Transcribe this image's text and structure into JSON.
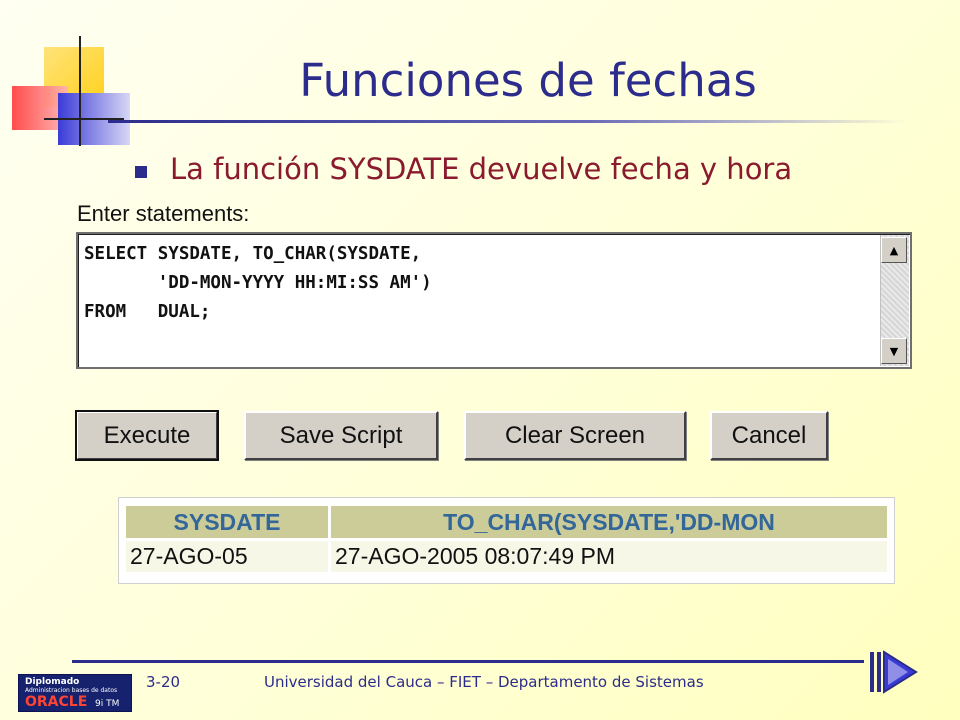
{
  "slide": {
    "title": "Funciones de fechas",
    "bullet": "La función SYSDATE devuelve fecha y hora"
  },
  "editor": {
    "label": "Enter statements:",
    "sql": "SELECT SYSDATE, TO_CHAR(SYSDATE,\n       'DD-MON-YYYY HH:MI:SS AM')\nFROM   DUAL;"
  },
  "toolbar": {
    "execute_label": "Execute",
    "save_label": "Save Script",
    "clear_label": "Clear Screen",
    "cancel_label": "Cancel"
  },
  "result": {
    "headers": [
      "SYSDATE",
      "TO_CHAR(SYSDATE,'DD-MON"
    ],
    "rows": [
      [
        "27-AGO-05",
        "27-AGO-2005 08:07:49 PM"
      ]
    ]
  },
  "footer": {
    "slide_number": "3-20",
    "text": "Universidad del Cauca – FIET – Departamento de Sistemas",
    "logo": {
      "line1": "Diplomado",
      "line2": "Administracion bases de datos",
      "brand": "ORACLE",
      "version": "9i TM"
    }
  },
  "colors": {
    "title": "#2c2c8c",
    "bullet_text": "#8a1a2e",
    "table_header_bg": "#cccc99",
    "table_header_text": "#336699",
    "button_face": "#d4d0c8"
  },
  "icons": {
    "scroll_up": "triangle-up",
    "scroll_down": "triangle-down",
    "nav": "next-slide-arrow"
  }
}
